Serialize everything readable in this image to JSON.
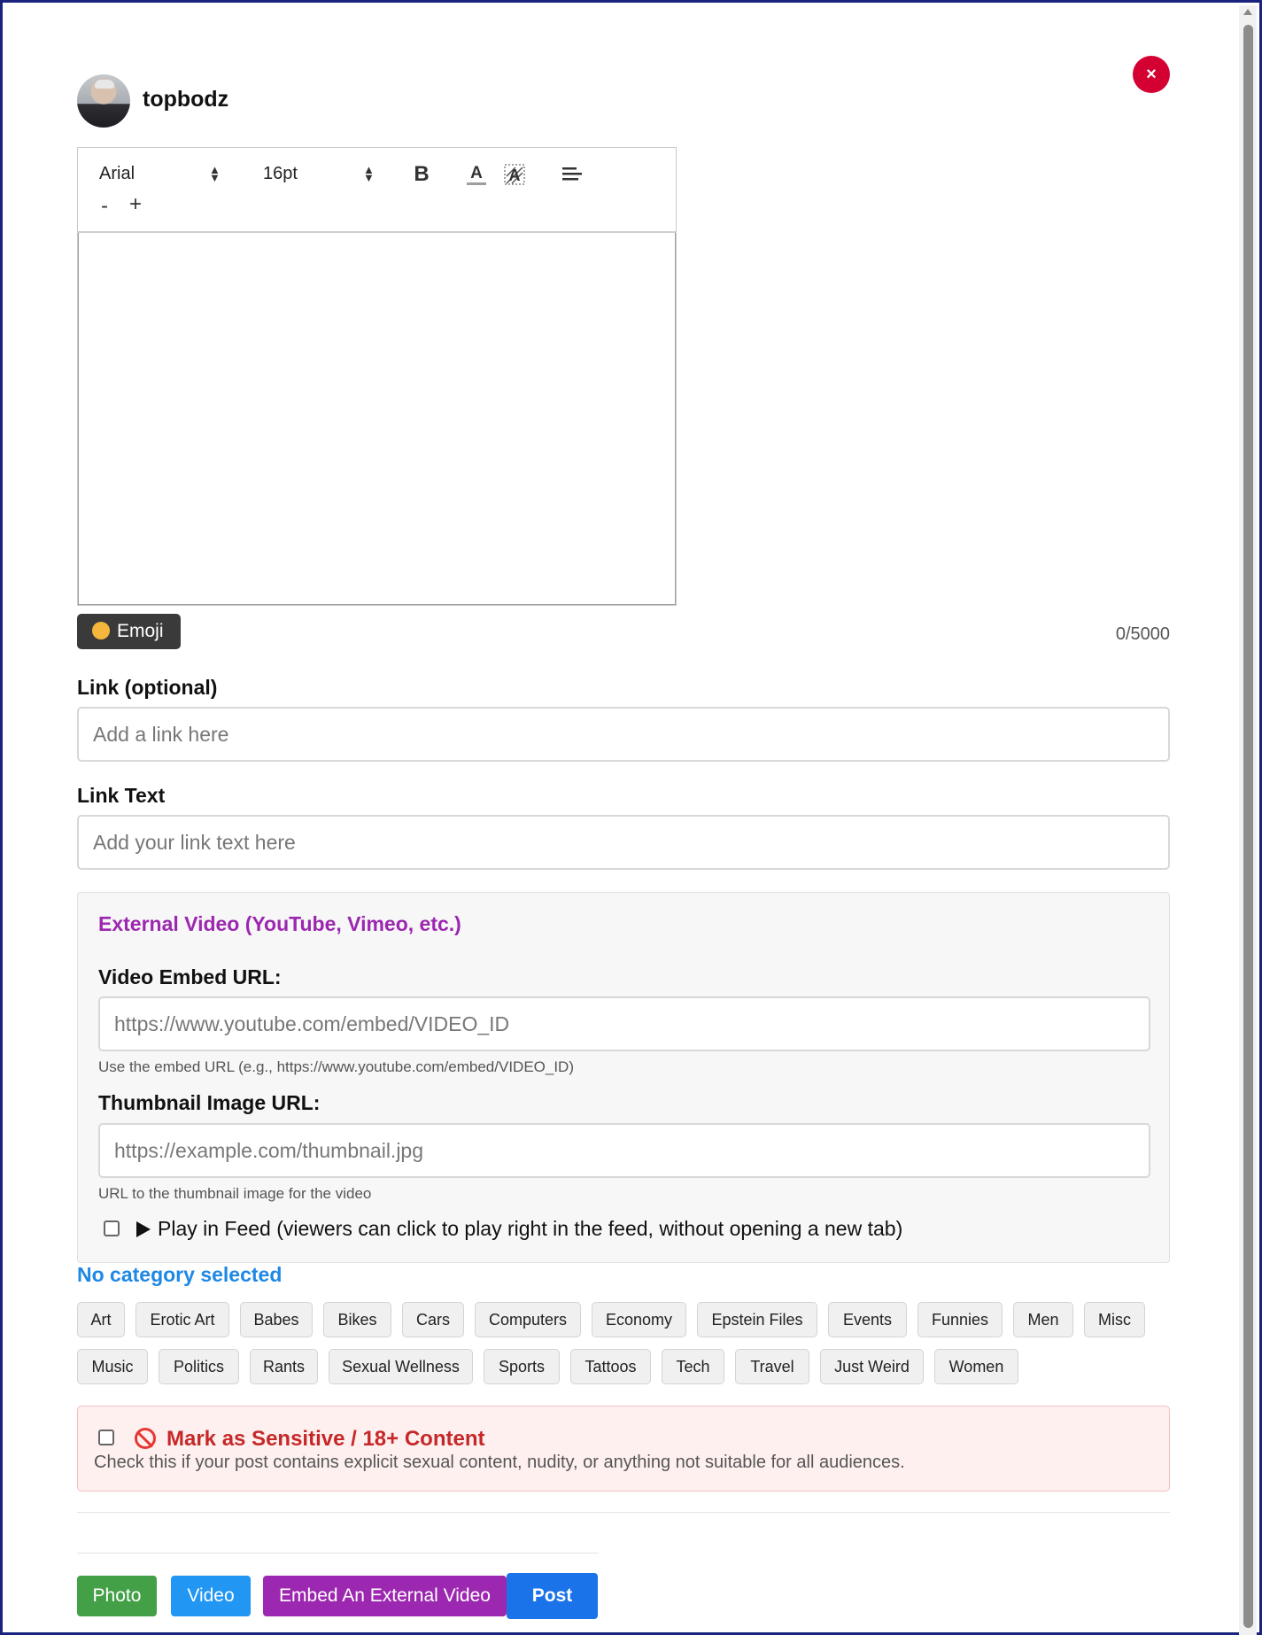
{
  "header": {
    "username": "topbodz",
    "close_label": "×"
  },
  "toolbar": {
    "font": "Arial",
    "size": "16pt",
    "bold_label": "B",
    "minus_label": "-",
    "plus_label": "+"
  },
  "emoji": {
    "label": "Emoji"
  },
  "counter": "0/5000",
  "link": {
    "label": "Link (optional)",
    "placeholder": "Add a link here"
  },
  "link_text": {
    "label": "Link Text",
    "placeholder": "Add your link text here"
  },
  "external_video": {
    "title": "External Video (YouTube, Vimeo, etc.)",
    "embed_label": "Video Embed URL:",
    "embed_placeholder": "https://www.youtube.com/embed/VIDEO_ID",
    "embed_hint": "Use the embed URL (e.g., https://www.youtube.com/embed/VIDEO_ID)",
    "thumb_label": "Thumbnail Image URL:",
    "thumb_placeholder": "https://example.com/thumbnail.jpg",
    "thumb_hint": "URL to the thumbnail image for the video",
    "play_in_feed": "Play in Feed (viewers can click to play right in the feed, without opening a new tab)"
  },
  "category": {
    "status": "No category selected",
    "row1": [
      "Art",
      "Erotic Art",
      "Babes",
      "Bikes",
      "Cars",
      "Computers",
      "Economy",
      "Epstein Files",
      "Events",
      "Funnies",
      "Men",
      "Misc"
    ],
    "row2": [
      "Music",
      "Politics",
      "Rants",
      "Sexual Wellness",
      "Sports",
      "Tattoos",
      "Tech",
      "Travel",
      "Just Weird",
      "Women"
    ]
  },
  "sensitive": {
    "title": "Mark as Sensitive / 18+ Content",
    "description": "Check this if your post contains explicit sexual content, nudity, or anything not suitable for all audiences."
  },
  "actions": {
    "photo": "Photo",
    "video": "Video",
    "embed": "Embed An External Video",
    "post": "Post"
  },
  "colors": {
    "close": "#d50032",
    "purple": "#9c27b0",
    "blue_link": "#1e88e5",
    "photo": "#43a047",
    "video": "#2196f3",
    "embed": "#9c27b0",
    "post": "#1a73e8",
    "sensitive_red": "#c62828"
  }
}
